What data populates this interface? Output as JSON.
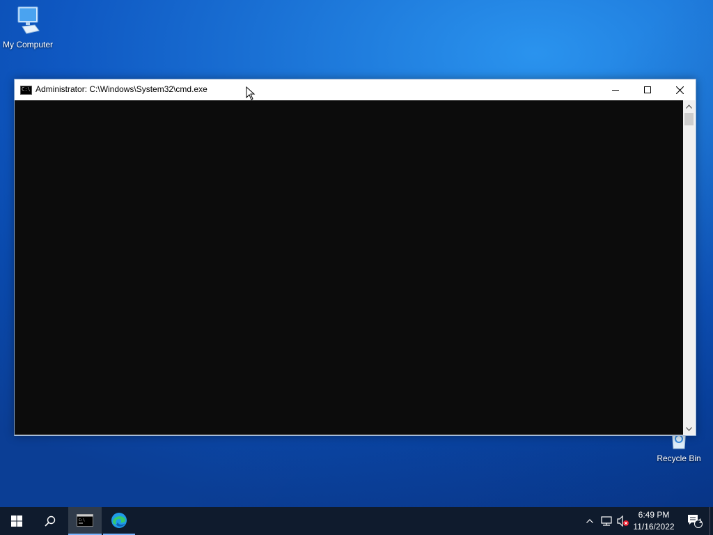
{
  "desktop": {
    "icons": [
      {
        "label": "My Computer"
      },
      {
        "label": "Recycle Bin"
      }
    ]
  },
  "window": {
    "title": "Administrator: C:\\Windows\\System32\\cmd.exe",
    "icon_text": "C:\\"
  },
  "taskbar": {
    "apps": [
      "cmd-icon",
      "edge-icon"
    ],
    "clock": {
      "time": "6:49 PM",
      "date": "11/16/2022"
    },
    "notifications": {
      "count": "1"
    }
  },
  "colors": {
    "console_bg": "#0c0c0c",
    "taskbar_bg": "#0f1b2d",
    "desktop_blue": "#1b73d6"
  }
}
